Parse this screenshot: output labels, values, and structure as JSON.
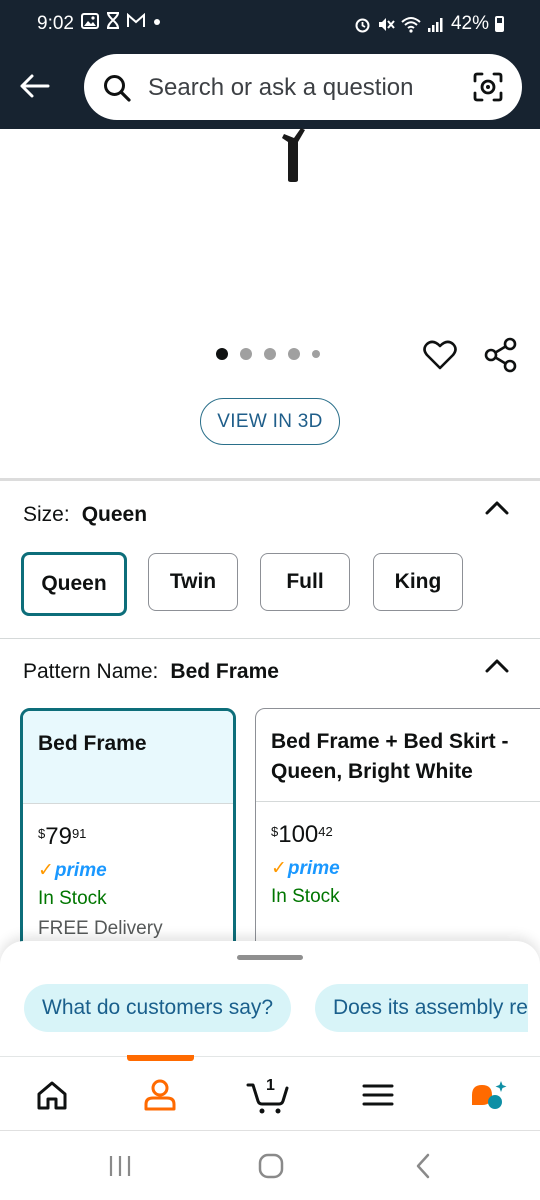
{
  "status_bar": {
    "time": "9:02",
    "battery": "42%"
  },
  "header": {
    "search_placeholder": "Search or ask a question"
  },
  "media": {
    "dot_count": 5,
    "active_dot": 1,
    "view3d_label": "VIEW IN 3D"
  },
  "size": {
    "label": "Size:",
    "selected": "Queen",
    "options": [
      "Queen",
      "Twin",
      "Full",
      "King"
    ]
  },
  "pattern": {
    "label": "Pattern Name:",
    "selected": "Bed Frame",
    "cards": [
      {
        "title": "Bed Frame",
        "price_dollars": "$79",
        "price_cents": "91",
        "prime": "prime",
        "stock": "In Stock",
        "delivery": "FREE Delivery"
      },
      {
        "title_line1": "Bed Frame + Bed Skirt -",
        "title_line2": "Queen, Bright White",
        "price_dollars": "$100",
        "price_cents": "42",
        "prime": "prime",
        "stock": "In Stock"
      }
    ]
  },
  "rufus": {
    "chips": [
      "What do customers say?",
      "Does its assembly re"
    ]
  },
  "bottom_nav": {
    "cart_count": "1",
    "active": "account"
  },
  "colors": {
    "header_bg": "#172330",
    "accent_teal": "#0d6e7a",
    "prime_blue": "#1a98ff",
    "stock_green": "#007600",
    "orange": "#ff6a00"
  }
}
